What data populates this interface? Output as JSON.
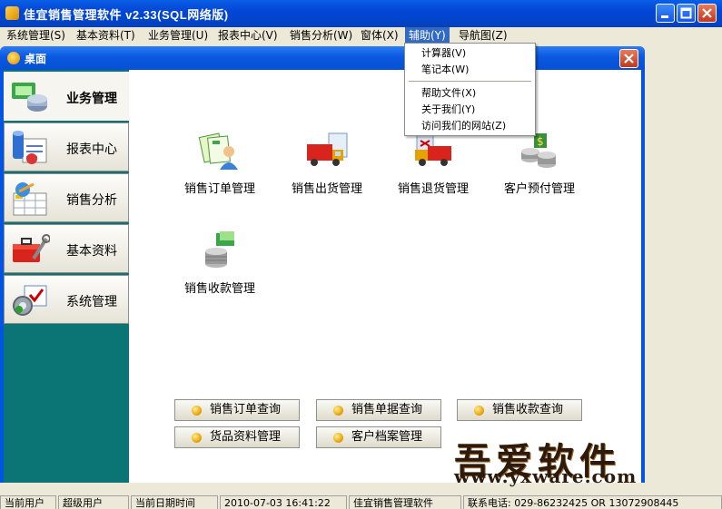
{
  "window": {
    "title": "佳宜销售管理软件  v2.33(SQL网络版)"
  },
  "menu": [
    {
      "label": "系统管理(S)"
    },
    {
      "label": "基本资料(T)"
    },
    {
      "label": "业务管理(U)"
    },
    {
      "label": "报表中心(V)"
    },
    {
      "label": "销售分析(W)"
    },
    {
      "label": "窗体(X)"
    },
    {
      "label": "辅助(Y)"
    },
    {
      "label": "导航图(Z)"
    }
  ],
  "dropdown": {
    "items": [
      "计算器(V)",
      "笔记本(W)",
      "帮助文件(X)",
      "关于我们(Y)",
      "访问我们的网站(Z)"
    ]
  },
  "child_window": {
    "title": "桌面"
  },
  "nav": [
    {
      "label": "业务管理",
      "icon": "business-icon"
    },
    {
      "label": "报表中心",
      "icon": "report-icon"
    },
    {
      "label": "销售分析",
      "icon": "analysis-icon"
    },
    {
      "label": "基本资料",
      "icon": "toolbox-icon"
    },
    {
      "label": "系统管理",
      "icon": "settings-icon"
    }
  ],
  "features": [
    {
      "label": "销售订单管理",
      "icon": "sales-order-icon"
    },
    {
      "label": "销售出货管理",
      "icon": "delivery-truck-icon"
    },
    {
      "label": "销售退货管理",
      "icon": "return-truck-icon"
    },
    {
      "label": "客户预付管理",
      "icon": "prepayment-coins-icon"
    },
    {
      "label": "销售收款管理",
      "icon": "receipt-coins-icon"
    }
  ],
  "quick_buttons": [
    {
      "label": "销售订单查询"
    },
    {
      "label": "销售单据查询"
    },
    {
      "label": "销售收款查询"
    },
    {
      "label": "货品资料管理"
    },
    {
      "label": "客户档案管理"
    }
  ],
  "watermark": {
    "title": "吾爱软件",
    "url": "www.yxware.com"
  },
  "status": {
    "user_label": "当前用户",
    "user_value": "超级用户",
    "date_label": "当前日期时间",
    "date_value": "2010-07-03 16:41:22",
    "app_name": "佳宜销售管理软件",
    "contact": "联系电话: 029-86232425  OR  13072908445"
  },
  "colors": {
    "title_blue": "#0346d7",
    "nav_teal": "#0b7474",
    "menu_highlight": "#316ac5"
  }
}
